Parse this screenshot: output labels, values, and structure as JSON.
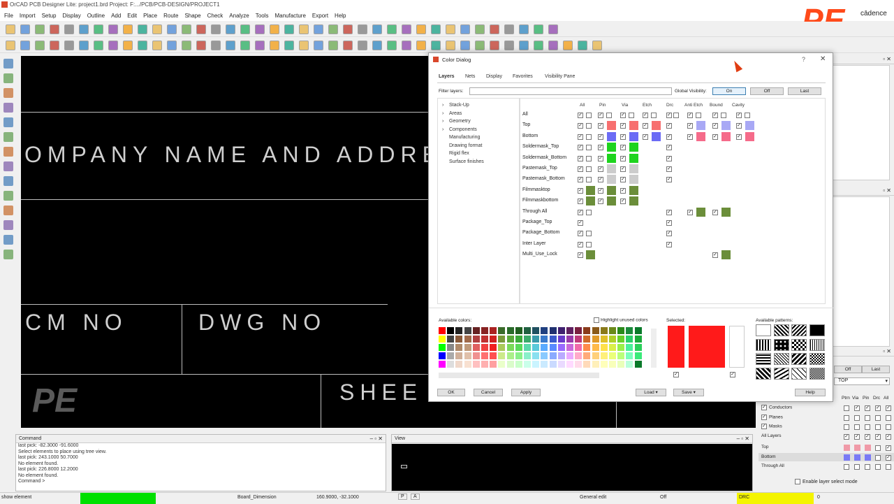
{
  "app": {
    "title": "OrCAD PCB Designer Lite: project1.brd  Project: F:.../PCB/PCB-DESIGN/PROJECT1",
    "logo_text": "PE",
    "brand": "cādence",
    "menu": [
      "File",
      "Import",
      "Setup",
      "Display",
      "Outline",
      "Add",
      "Edit",
      "Place",
      "Route",
      "Shape",
      "Check",
      "Analyze",
      "Tools",
      "Manufacture",
      "Export",
      "Help"
    ]
  },
  "canvas": {
    "company": "OMPANY NAME AND ADDRESS",
    "cm_no": "CM NO",
    "dwg_no": "DWG NO",
    "sheet": "SHEE",
    "watermark": "PE"
  },
  "command": {
    "title": "Command",
    "lines": [
      "last pick:  -82.3000 -91.6000",
      "Select elements to place using tree view.",
      "last pick:  243.1000 50.7000",
      "No element found.",
      "last pick:  226.8000 12.2000",
      "No element found.",
      "Command >"
    ]
  },
  "view": {
    "title": "View"
  },
  "status": {
    "mode": "show element",
    "dimension": "Board_Dimension",
    "coords": "160.9000, -32.1000",
    "p": "P",
    "a": "A",
    "edit": "General edit",
    "off": "Off",
    "drc": "DRC",
    "drc_count": "0"
  },
  "dialog": {
    "title": "Color Dialog",
    "tabs": [
      "Layers",
      "Nets",
      "Display",
      "Favorites",
      "Visibility Pane"
    ],
    "filter_label": "Filter layers:",
    "global_vis_label": "Global Visibility:",
    "btn_on": "On",
    "btn_off": "Off",
    "btn_last": "Last",
    "tree": [
      "Stack-Up",
      "Areas",
      "Geometry",
      "Components",
      "Manufacturing",
      "Drawing format",
      "Rigid flex",
      "Surface finishes"
    ],
    "columns": [
      "All",
      "Pin",
      "Via",
      "Etch",
      "Drc",
      "Anti Etch",
      "Bound",
      "Cavity"
    ],
    "rows": [
      "All",
      "Top",
      "Bottom",
      "Soldermask_Top",
      "Soldermask_Bottom",
      "Pastemask_Top",
      "Pastemask_Bottom",
      "Filmmasktop",
      "Filmmaskbottom",
      "Through All",
      "Package_Top",
      "Package_Bottom",
      "Inter Layer",
      "Multi_Use_Lock"
    ],
    "available_colors": "Available colors:",
    "highlight_unused": "Highlight unused colors",
    "selected": "Selected:",
    "available_patterns": "Available patterns:",
    "ok": "OK",
    "cancel": "Cancel",
    "apply": "Apply",
    "load": "Load",
    "save": "Save",
    "help": "Help",
    "selected_color": "#ff1a1a"
  },
  "right_panel": {
    "off": "Off",
    "last": "Last",
    "top_select": "TOP",
    "col_hdrs": [
      "Ptrn",
      "Via",
      "Pin",
      "Drc",
      "All"
    ],
    "groups": [
      "Conductors",
      "Planes",
      "Masks",
      "All Layers"
    ],
    "layers": [
      "Top",
      "Bottom",
      "Through All"
    ],
    "enable_layer": "Enable layer select mode"
  }
}
